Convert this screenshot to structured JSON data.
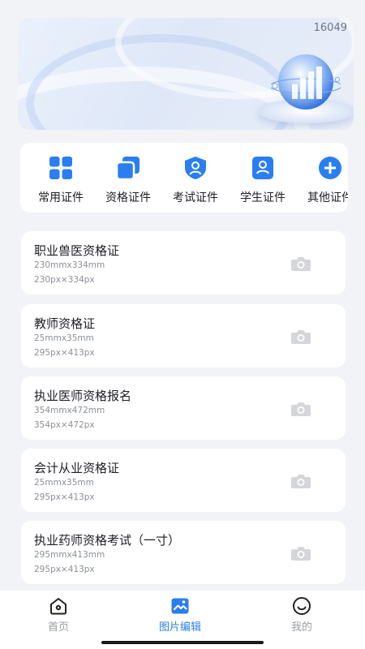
{
  "banner": {
    "count": "16049"
  },
  "categories": [
    {
      "label": "常用证件",
      "icon": "grid-icon"
    },
    {
      "label": "资格证件",
      "icon": "copy-icon"
    },
    {
      "label": "考试证件",
      "icon": "shield-user-icon"
    },
    {
      "label": "学生证件",
      "icon": "student-badge-icon"
    },
    {
      "label": "其他证件",
      "icon": "plus-circle-icon"
    }
  ],
  "cards": [
    {
      "title": "职业兽医资格证",
      "mm": "230mmx334mm",
      "px": "230px×334px"
    },
    {
      "title": "教师资格证",
      "mm": "25mmx35mm",
      "px": "295px×413px"
    },
    {
      "title": "执业医师资格报名",
      "mm": "354mmx472mm",
      "px": "354px×472px"
    },
    {
      "title": "会计从业资格证",
      "mm": "25mmx35mm",
      "px": "295px×413px"
    },
    {
      "title": "执业药师资格考试（一寸）",
      "mm": "295mmx413mm",
      "px": "295px×413px"
    }
  ],
  "nav": {
    "items": [
      {
        "label": "首页",
        "icon": "home-icon"
      },
      {
        "label": "图片编辑",
        "icon": "image-edit-icon"
      },
      {
        "label": "我的",
        "icon": "smile-icon"
      }
    ],
    "active_index": 1
  },
  "colors": {
    "accent": "#2a7ef0",
    "muted": "#8b8f97",
    "nav_inactive": "#9a9ea6"
  }
}
